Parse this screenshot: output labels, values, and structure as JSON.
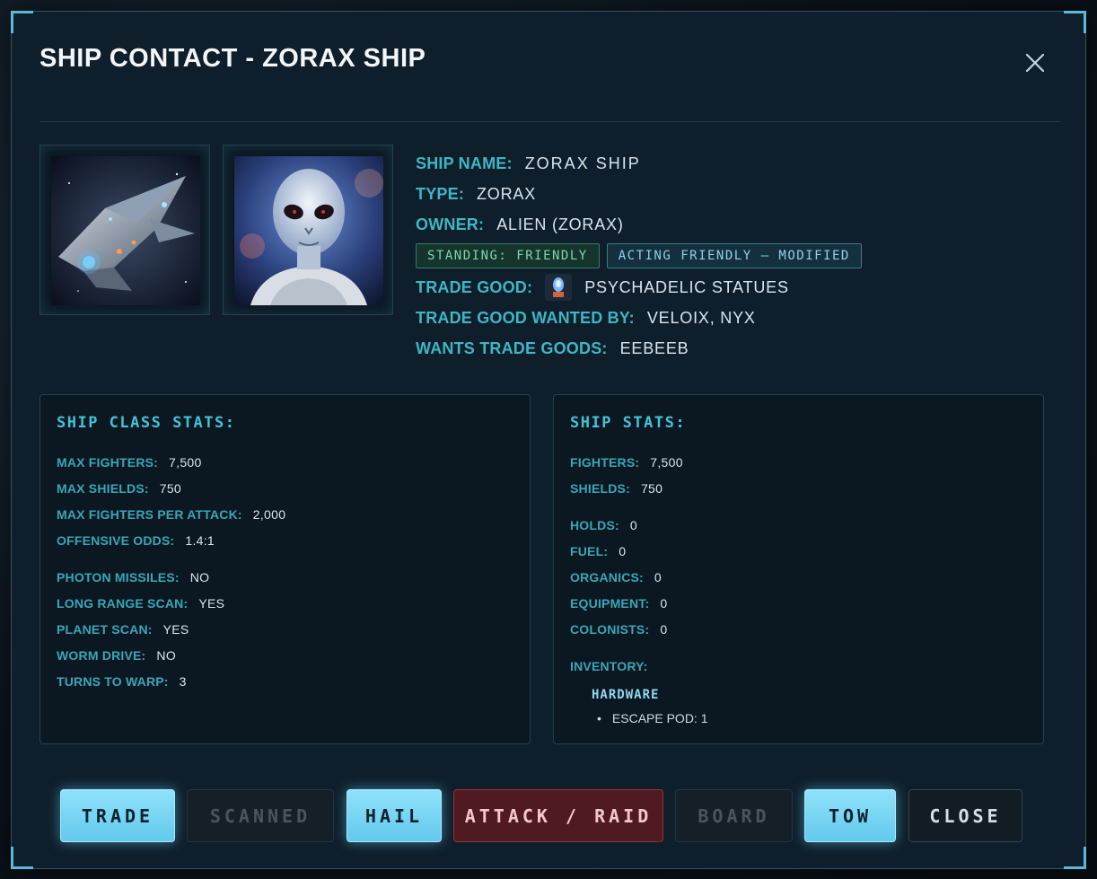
{
  "dialog": {
    "title": "SHIP CONTACT - ZORAX SHIP"
  },
  "ship": {
    "name_label": "SHIP NAME:",
    "name": "ZORAX SHIP",
    "type_label": "TYPE:",
    "type": "ZORAX",
    "owner_label": "OWNER:",
    "owner": "ALIEN (ZORAX)",
    "standing_badge": "STANDING: FRIENDLY",
    "acting_badge": "ACTING FRIENDLY — MODIFIED",
    "trade_good_label": "TRADE GOOD:",
    "trade_good": "PSYCHADELIC STATUES",
    "trade_good_wanted_label": "TRADE GOOD WANTED BY:",
    "trade_good_wanted": "VELOIX, NYX",
    "wants_trade_goods_label": "WANTS TRADE GOODS:",
    "wants_trade_goods": "EEBEEB"
  },
  "class_stats": {
    "title": "SHIP CLASS STATS:",
    "rows": [
      {
        "label": "MAX FIGHTERS:",
        "value": "7,500"
      },
      {
        "label": "MAX SHIELDS:",
        "value": "750"
      },
      {
        "label": "MAX FIGHTERS PER ATTACK:",
        "value": "2,000"
      },
      {
        "label": "OFFENSIVE ODDS:",
        "value": "1.4:1"
      },
      {
        "label": "PHOTON MISSILES:",
        "value": "NO"
      },
      {
        "label": "LONG RANGE SCAN:",
        "value": "YES"
      },
      {
        "label": "PLANET SCAN:",
        "value": "YES"
      },
      {
        "label": "WORM DRIVE:",
        "value": "NO"
      },
      {
        "label": "TURNS TO WARP:",
        "value": "3"
      }
    ]
  },
  "ship_stats": {
    "title": "SHIP STATS:",
    "rows": [
      {
        "label": "FIGHTERS:",
        "value": "7,500"
      },
      {
        "label": "SHIELDS:",
        "value": "750"
      },
      {
        "label": "HOLDS:",
        "value": "0"
      },
      {
        "label": "FUEL:",
        "value": "0"
      },
      {
        "label": "ORGANICS:",
        "value": "0"
      },
      {
        "label": "EQUIPMENT:",
        "value": "0"
      },
      {
        "label": "COLONISTS:",
        "value": "0"
      }
    ],
    "inventory_label": "INVENTORY:",
    "hardware_title": "HARDWARE",
    "hardware_items": [
      "ESCAPE POD: 1"
    ]
  },
  "actions": {
    "trade": "TRADE",
    "scanned": "SCANNED",
    "hail": "HAIL",
    "attack": "ATTACK / RAID",
    "board": "BOARD",
    "tow": "TOW",
    "close": "CLOSE"
  },
  "icons": {
    "close": "close-icon",
    "ship_portrait": "ship-image",
    "alien_portrait": "alien-image",
    "trade_good": "statue-icon"
  },
  "colors": {
    "accent": "#3fb6c4",
    "primary_button": "#74d3f1",
    "danger_button": "#4f1a22"
  }
}
